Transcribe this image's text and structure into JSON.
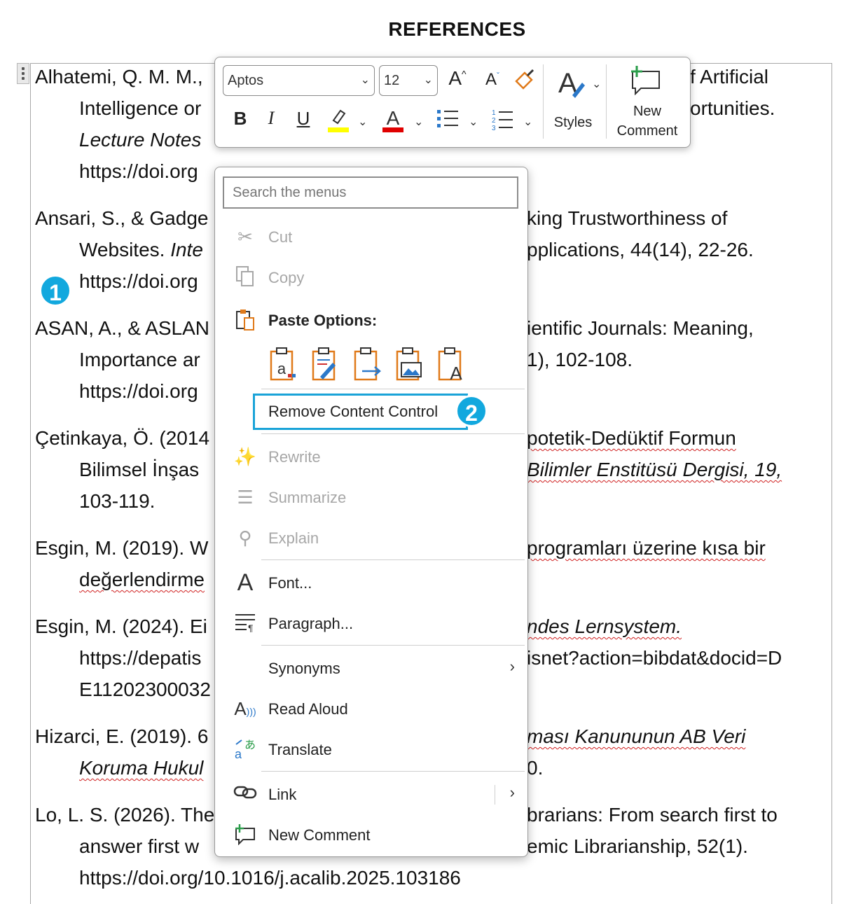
{
  "heading": "REFERENCES",
  "references": [
    {
      "lines": [
        "Alhatemi, Q. M. M.,",
        "Intelligence or",
        "Lecture Notes",
        "https://doi.org"
      ],
      "right": [
        "f Artificial",
        "ortunities.",
        "",
        ""
      ]
    },
    {
      "lines": [
        "Ansari, S., & Gadge",
        "Websites. ",
        "https://doi.org"
      ],
      "italic_mid": "Inte",
      "right": [
        "king Trustworthiness of",
        "pplications, 44(14), 22-26.",
        ""
      ]
    },
    {
      "lines": [
        "ASAN, A., & ASLAN",
        "Importance ar",
        "https://doi.org"
      ],
      "right": [
        "ientific Journals: Meaning,",
        "1), 102-108.",
        ""
      ]
    },
    {
      "lines": [
        "Çetinkaya, Ö. (2014",
        "Bilimsel İnşas",
        "103-119."
      ],
      "right": [
        "potetik-Dedüktif Formun",
        "Bilimler Enstitüsü Dergisi, 19,",
        ""
      ]
    },
    {
      "lines": [
        "Esgin, M. (2019). W",
        "değerlendirme"
      ],
      "right": [
        "programları üzerine kısa bir",
        ""
      ]
    },
    {
      "lines": [
        "Esgin, M. (2024). Ei",
        "https://depatis",
        "E11202300032"
      ],
      "right": [
        "ndes Lernsystem.",
        "isnet?action=bibdat&docid=D",
        ""
      ]
    },
    {
      "lines": [
        "Hizarci, E. (2019). 6",
        "Koruma Hukul"
      ],
      "right": [
        "ması Kanununun AB Veri",
        "0."
      ]
    },
    {
      "lines": [
        "Lo, L. S. (2026). The",
        "answer first w",
        "https://doi.org/10.1016/j.acalib.2025.103186"
      ],
      "right": [
        "brarians: From search first to",
        "emic Librarianship, 52(1).",
        ""
      ]
    }
  ],
  "badges": {
    "one": "1",
    "two": "2"
  },
  "mini_toolbar": {
    "font_name": "Aptos",
    "font_size": "12",
    "bold": "B",
    "italic": "I",
    "underline": "U",
    "styles_label": "Styles",
    "new_comment_line1": "New",
    "new_comment_line2": "Comment",
    "highlight_color": "#ffff00",
    "font_color": "#e00000"
  },
  "context_menu": {
    "search_placeholder": "Search the menus",
    "cut": "Cut",
    "copy": "Copy",
    "paste_options": "Paste Options:",
    "remove_content_control": "Remove Content Control",
    "rewrite": "Rewrite",
    "summarize": "Summarize",
    "explain": "Explain",
    "font": "Font...",
    "paragraph": "Paragraph...",
    "synonyms": "Synonyms",
    "read_aloud": "Read Aloud",
    "translate": "Translate",
    "link": "Link",
    "new_comment": "New Comment"
  },
  "colors": {
    "accent": "#1aa3d8",
    "paste_orange": "#e07a1a",
    "paste_blue": "#2b78c9"
  }
}
